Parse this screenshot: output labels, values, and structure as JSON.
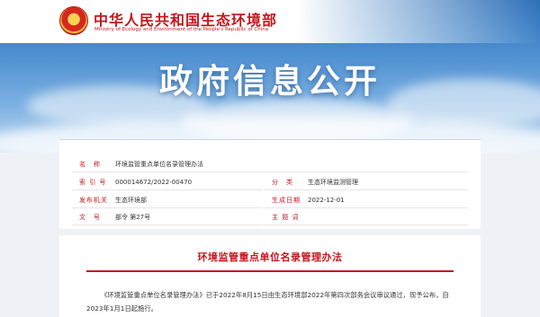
{
  "header": {
    "site_name": "中华人民共和国生态环境部",
    "site_name_en": "Ministry of Ecology and Environment of the People's Republic of China",
    "page_heading": "政府信息公开"
  },
  "meta": {
    "name_label": "名　称",
    "name_value": "环境监管重点单位名录管理办法",
    "index_label": "索 引 号",
    "index_value": "000014672/2022-00470",
    "category_label": "分　类",
    "category_value": "生态环境监测管理",
    "issuer_label": "发布机关",
    "issuer_value": "生态环境部",
    "date_label": "生成日期",
    "date_value": "2022-12-01",
    "docno_label": "文　号",
    "docno_value": "部令 第27号",
    "topic_label": "主 题 词",
    "topic_value": ""
  },
  "document": {
    "title": "环境监管重点单位名录管理办法",
    "body": "《环境监管重点单位名录管理办法》已于2022年8月15日由生态环境部2022年第四次部务会议审议通过，现予公布，自2023年1月1日起施行。"
  },
  "colors": {
    "accent": "#c4161c",
    "sky": "#4d8fd0"
  }
}
